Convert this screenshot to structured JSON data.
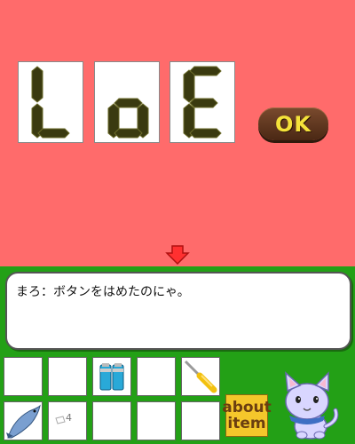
{
  "panel": {
    "digits": [
      "L",
      "o",
      "E"
    ],
    "ok_label": "OK"
  },
  "dialog": {
    "text": "まろ：ボタンをはめたのにゃ。"
  },
  "inventory": {
    "slots": [
      {
        "item": "empty"
      },
      {
        "item": "empty"
      },
      {
        "item": "batteries-icon"
      },
      {
        "item": "empty"
      },
      {
        "item": "screwdriver-icon"
      },
      {
        "item": "fish-icon"
      },
      {
        "item": "coin-icon"
      },
      {
        "item": "empty"
      },
      {
        "item": "empty"
      },
      {
        "item": "empty"
      }
    ],
    "coin_label": "4",
    "about_line1": "about",
    "about_line2": "item"
  },
  "colors": {
    "scene_bg": "#ff6b6b",
    "bottom_bg": "#23a016",
    "segment": "#3a3a10",
    "ok_text": "#f4e23a",
    "about_bg": "#f5c72b"
  }
}
